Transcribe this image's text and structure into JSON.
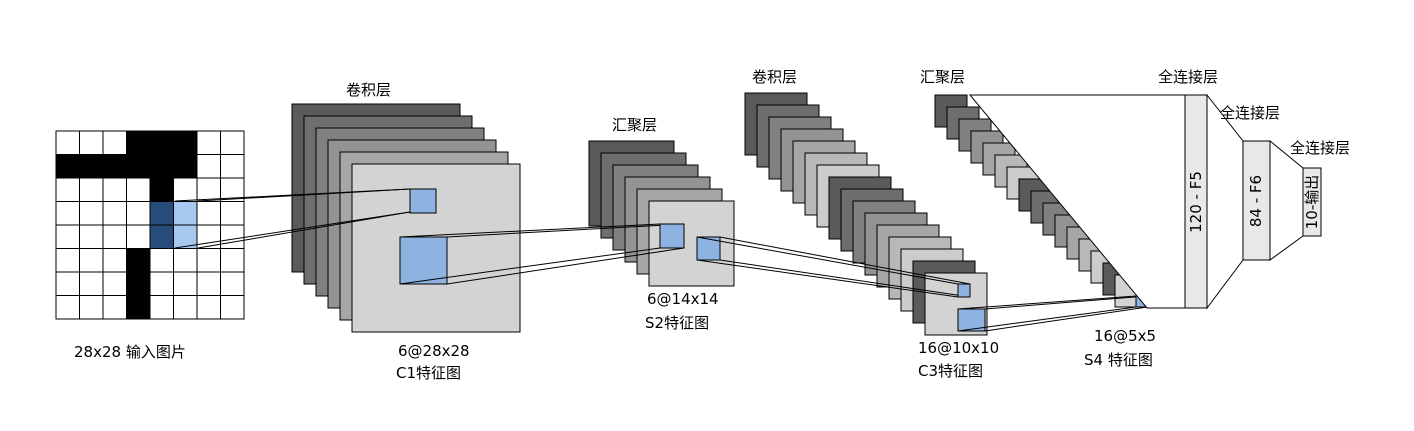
{
  "colors": {
    "map_palette": [
      "#5a5a5a",
      "#6e6e6e",
      "#808080",
      "#939393",
      "#a6a6a6",
      "#b8b8b8",
      "#cccccc"
    ],
    "front_map": "#d3d3d3",
    "highlight": "#8fb3e0",
    "pixel_dark_highlight": "#264d7a",
    "pixel_light_highlight": "#a8c8f0",
    "fc_fill": "#e8e8e8",
    "stroke": "#000000"
  },
  "input": {
    "label": "28x28 输入图片"
  },
  "c1": {
    "top_label": "卷积层",
    "size_label": "6@28x28",
    "name_label": "C1特征图"
  },
  "s2": {
    "top_label": "汇聚层",
    "size_label": "6@14x14",
    "name_label": "S2特征图"
  },
  "c3": {
    "top_label": "卷积层",
    "size_label": "16@10x10",
    "name_label": "C3特征图"
  },
  "s4": {
    "top_label": "汇聚层",
    "size_label": "16@5x5",
    "name_label": "S4 特征图"
  },
  "f5": {
    "top_label": "全连接层",
    "text": "120 - F5"
  },
  "f6": {
    "top_label": "全连接层",
    "text": "84 - F6"
  },
  "out": {
    "top_label": "全连接层",
    "text": "10-输出"
  }
}
